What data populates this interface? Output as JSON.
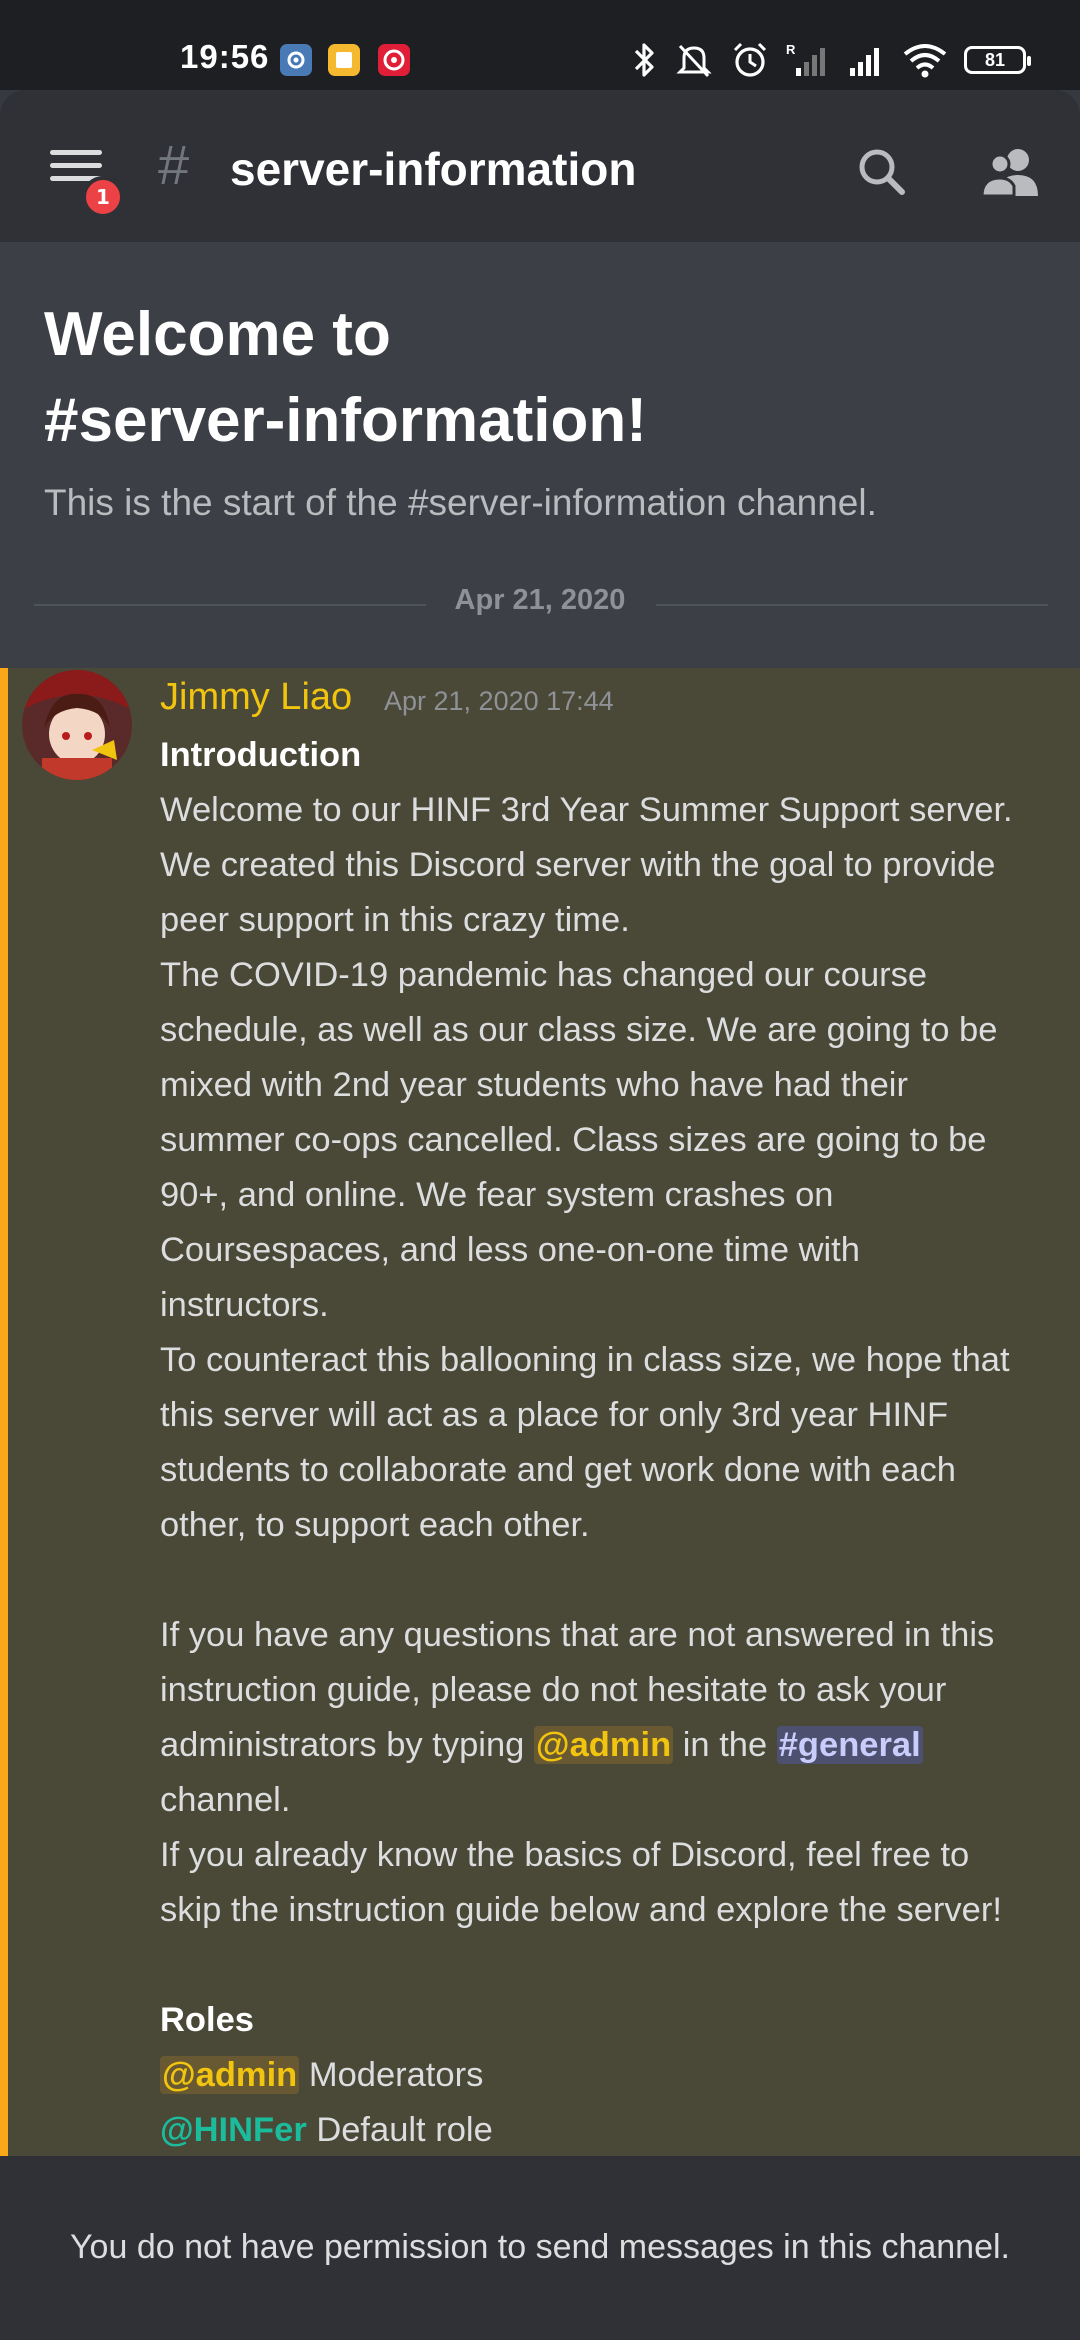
{
  "status_bar": {
    "time": "19:56",
    "battery": "81",
    "notif_icons": [
      "settings-app-icon",
      "notes-app-icon",
      "target-app-icon"
    ],
    "system_icons": [
      "bluetooth-icon",
      "mute-icon",
      "alarm-icon",
      "signal-roaming-icon",
      "signal-icon",
      "wifi-icon",
      "battery-icon"
    ]
  },
  "header": {
    "hash": "#",
    "channel_name": "server-information",
    "notification_badge": "1"
  },
  "welcome": {
    "title_line1": "Welcome to",
    "title_line2": "#server-information!",
    "subtitle": "This is the start of the #server-information channel.",
    "date_divider": "Apr 21, 2020"
  },
  "message": {
    "author": "Jimmy Liao",
    "timestamp": "Apr 21, 2020 17:44",
    "heading": "Introduction",
    "lines": [
      "Welcome to our HINF 3rd Year Summer Support server.",
      "We created this Discord server with the goal to provide",
      "peer support in this crazy time.",
      "The COVID-19 pandemic has changed our course",
      "schedule, as well as our class size. We are going to be",
      "mixed with 2nd year students who have had their",
      "summer co-ops cancelled. Class sizes are going to be",
      "90+, and online. We fear system crashes on",
      "Coursespaces, and less one-on-one time with",
      "instructors.",
      "To counteract this ballooning in class size, we hope that",
      "this server will act as a place for only 3rd year HINF",
      "students to collaborate and get work done with each",
      "other, to support each other."
    ],
    "q_line1": "If you have any questions that are not answered in this",
    "q_line2": "instruction guide, please do not hesitate to ask your",
    "q_line3_pre": "administrators by typing ",
    "mention_admin": "@admin",
    "q_line3_mid": " in the ",
    "mention_general": "#general",
    "q_line4": "channel.",
    "basics_line1": "If you already know the basics of Discord, feel free to",
    "basics_line2": "skip the instruction guide below and explore the server!",
    "roles_heading": "Roles",
    "role_admin": "@admin",
    "role_admin_desc": " Moderators",
    "role_hinfer": "@HINFer",
    "role_hinfer_desc": " Default role"
  },
  "footer": {
    "text": "You do not have permission to send messages in this channel."
  },
  "colors": {
    "background": "#36393f",
    "header": "#2f3136",
    "author": "#f1c40f",
    "highlight_border": "#faa81a",
    "badge": "#ed4245",
    "hinfer_role": "#1abc9c"
  }
}
